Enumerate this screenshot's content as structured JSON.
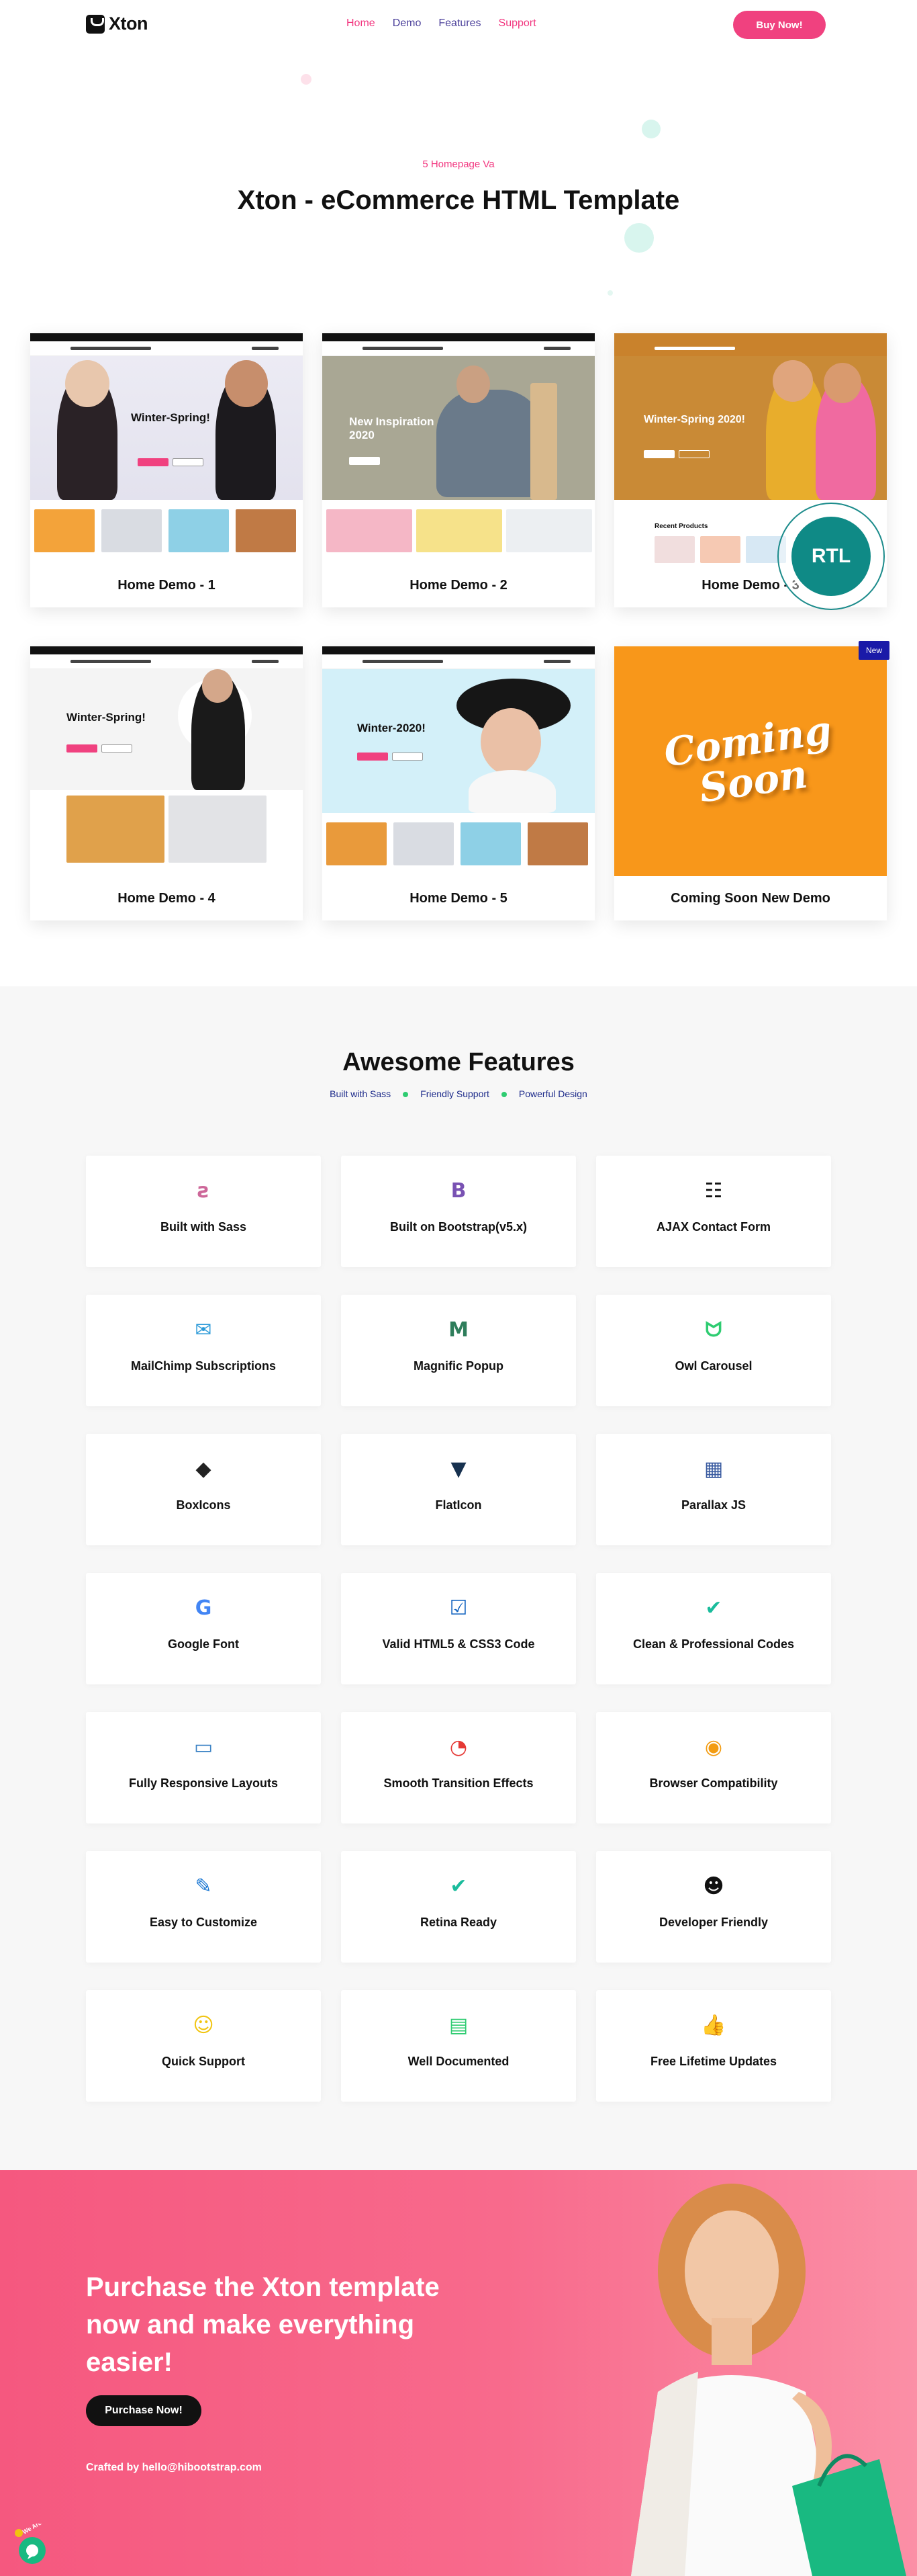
{
  "header": {
    "logo": "Xton",
    "nav": [
      "Home",
      "Demo",
      "Features",
      "Support"
    ],
    "buy_label": "Buy Now!"
  },
  "hero": {
    "subtitle": "5 Homepage Va",
    "title": "Xton - eCommerce HTML Template"
  },
  "demos": [
    {
      "label": "Home Demo - 1",
      "banner_text": "Winter-Spring!"
    },
    {
      "label": "Home Demo - 2",
      "banner_text": "New Inspiration 2020"
    },
    {
      "label": "Home Demo - 3",
      "banner_text": "Winter-Spring 2020!",
      "extra": "Recent Products"
    },
    {
      "label": "Home Demo - 4",
      "banner_text": "Winter-Spring!"
    },
    {
      "label": "Home Demo - 5",
      "banner_text": "Winter-2020!"
    },
    {
      "label": "Coming Soon New Demo",
      "banner_text": "Coming Soon"
    }
  ],
  "badges": {
    "rtl": "RTL",
    "new": "New"
  },
  "features": {
    "title": "Awesome Features",
    "tags": [
      "Built with Sass",
      "Friendly Support",
      "Powerful Design"
    ],
    "items": [
      {
        "label": "Built with Sass",
        "icon": "sass-icon",
        "color": "#cd6799"
      },
      {
        "label": "Built on Bootstrap(v5.x)",
        "icon": "bootstrap-icon",
        "color": "#7952b3"
      },
      {
        "label": "AJAX Contact Form",
        "icon": "contact-book-icon",
        "color": "#111111"
      },
      {
        "label": "MailChimp Subscriptions",
        "icon": "mailchimp-icon",
        "color": "#2c9ad8"
      },
      {
        "label": "Magnific Popup",
        "icon": "magnific-popup-icon",
        "color": "#2e7d5b"
      },
      {
        "label": "Owl Carousel",
        "icon": "owl-icon",
        "color": "#2ecc71"
      },
      {
        "label": "BoxIcons",
        "icon": "boxicons-icon",
        "color": "#222222"
      },
      {
        "label": "FlatIcon",
        "icon": "flaticon-icon",
        "color": "#17314f"
      },
      {
        "label": "Parallax JS",
        "icon": "parallax-icon",
        "color": "#3a5ba0"
      },
      {
        "label": "Google Font",
        "icon": "google-icon",
        "color": "#4285f4"
      },
      {
        "label": "Valid HTML5 & CSS3 Code",
        "icon": "checkbox-icon",
        "color": "#1565c0"
      },
      {
        "label": "Clean & Professional Codes",
        "icon": "check-circle-icon",
        "color": "#1abc9c"
      },
      {
        "label": "Fully Responsive Layouts",
        "icon": "devices-icon",
        "color": "#3b82c4"
      },
      {
        "label": "Smooth Transition Effects",
        "icon": "transition-icon",
        "color": "#e53935"
      },
      {
        "label": "Browser Compatibility",
        "icon": "browser-icon",
        "color": "#f39c12"
      },
      {
        "label": "Easy to Customize",
        "icon": "wrench-icon",
        "color": "#1976d2"
      },
      {
        "label": "Retina Ready",
        "icon": "retina-icon",
        "color": "#1abc9c"
      },
      {
        "label": "Developer Friendly",
        "icon": "developer-icon",
        "color": "#111111"
      },
      {
        "label": "Quick Support",
        "icon": "support-icon",
        "color": "#f1c40f"
      },
      {
        "label": "Well Documented",
        "icon": "document-icon",
        "color": "#2ecc71"
      },
      {
        "label": "Free Lifetime Updates",
        "icon": "thumbs-up-icon",
        "color": "#3b82c4"
      }
    ]
  },
  "cta": {
    "title": "Purchase the Xton template now and make everything easier!",
    "button": "Purchase Now!",
    "credit": "Crafted by hello@hibootstrap.com"
  },
  "chat": {
    "label": "We Are Here!"
  },
  "colors": {
    "accent": "#f0417f",
    "nav": "#4a3f9a",
    "cta_bg": "#f86a8c",
    "teal": "#0f8a86"
  }
}
